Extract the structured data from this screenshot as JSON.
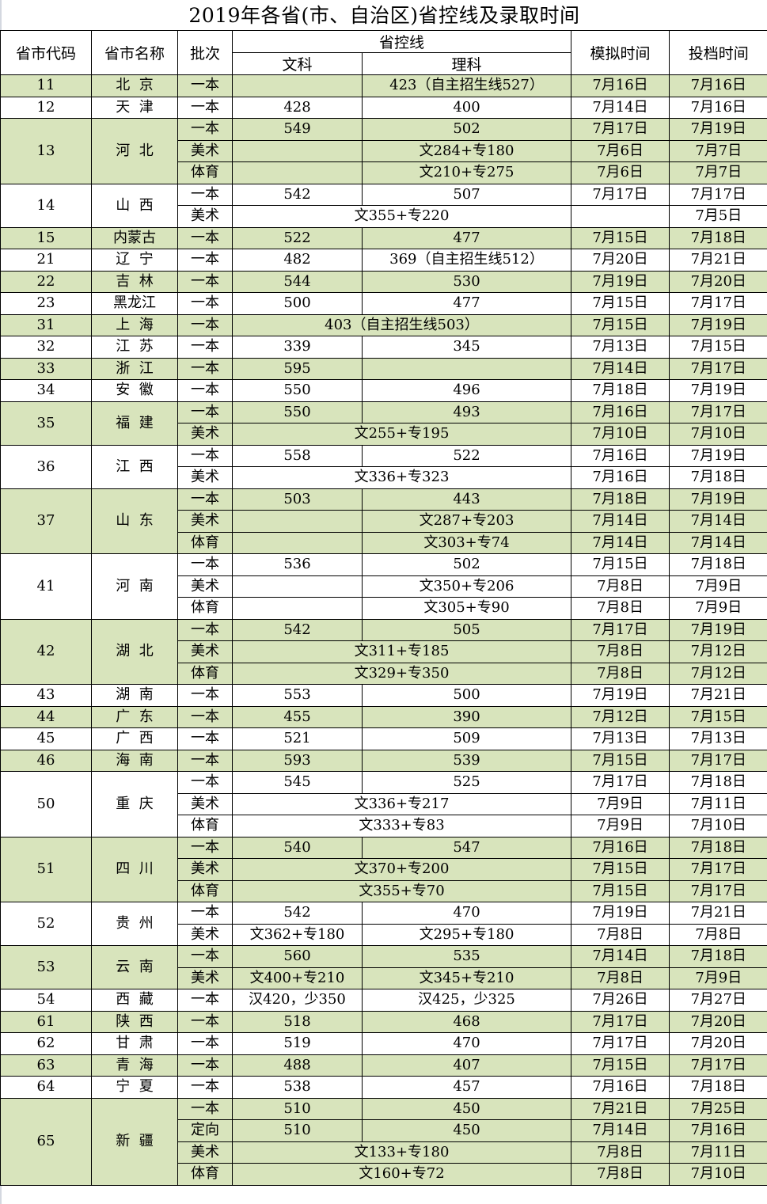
{
  "title": "2019年各省(市、自治区)省控线及录取时间",
  "colors": {
    "band_green": "#d8e4bc",
    "band_white": "#ffffff",
    "border": "#000000"
  },
  "headers": {
    "code": "省市代码",
    "name": "省市名称",
    "batch": "批次",
    "control_line": "省控线",
    "arts": "文科",
    "science": "理科",
    "mock_time": "模拟时间",
    "file_time": "投档时间"
  },
  "provinces": [
    {
      "code": "11",
      "name": "北  京",
      "band": "g",
      "rows": [
        {
          "batch": "一本",
          "arts": "",
          "science": "423（自主招生线527）",
          "mock": "7月16日",
          "file": "7月16日"
        }
      ]
    },
    {
      "code": "12",
      "name": "天  津",
      "band": "w",
      "rows": [
        {
          "batch": "一本",
          "arts": "428",
          "science": "400",
          "mock": "7月14日",
          "file": "7月16日"
        }
      ]
    },
    {
      "code": "13",
      "name": "河  北",
      "band": "g",
      "rows": [
        {
          "batch": "一本",
          "arts": "549",
          "science": "502",
          "mock": "7月17日",
          "file": "7月19日"
        },
        {
          "batch": "美术",
          "arts": "",
          "science": "文284+专180",
          "mock": "7月6日",
          "file": "7月7日"
        },
        {
          "batch": "体育",
          "arts": "",
          "science": "文210+专275",
          "mock": "7月6日",
          "file": "7月7日"
        }
      ]
    },
    {
      "code": "14",
      "name": "山  西",
      "band": "w",
      "rows": [
        {
          "batch": "一本",
          "arts": "542",
          "science": "507",
          "mock": "7月17日",
          "file": "7月17日"
        },
        {
          "batch": "美术",
          "merged": "文355+专220",
          "mock": "",
          "file": "7月5日"
        }
      ]
    },
    {
      "code": "15",
      "name": "内蒙古",
      "band": "g",
      "rows": [
        {
          "batch": "一本",
          "arts": "522",
          "science": "477",
          "mock": "7月15日",
          "file": "7月18日"
        }
      ]
    },
    {
      "code": "21",
      "name": "辽  宁",
      "band": "w",
      "rows": [
        {
          "batch": "一本",
          "arts": "482",
          "science": "369（自主招生线512）",
          "mock": "7月20日",
          "file": "7月21日"
        }
      ]
    },
    {
      "code": "22",
      "name": "吉  林",
      "band": "g",
      "rows": [
        {
          "batch": "一本",
          "arts": "544",
          "science": "530",
          "mock": "7月19日",
          "file": "7月20日"
        }
      ]
    },
    {
      "code": "23",
      "name": "黑龙江",
      "band": "w",
      "rows": [
        {
          "batch": "一本",
          "arts": "500",
          "science": "477",
          "mock": "7月15日",
          "file": "7月17日"
        }
      ]
    },
    {
      "code": "31",
      "name": "上  海",
      "band": "g",
      "rows": [
        {
          "batch": "一本",
          "merged": "403（自主招生线503）",
          "mock": "7月15日",
          "file": "7月19日"
        }
      ]
    },
    {
      "code": "32",
      "name": "江  苏",
      "band": "w",
      "rows": [
        {
          "batch": "一本",
          "arts": "339",
          "science": "345",
          "mock": "7月13日",
          "file": "7月15日"
        }
      ]
    },
    {
      "code": "33",
      "name": "浙  江",
      "band": "g",
      "rows": [
        {
          "batch": "一本",
          "arts": "595",
          "science": "",
          "mock": "7月14日",
          "file": "7月17日"
        }
      ]
    },
    {
      "code": "34",
      "name": "安  徽",
      "band": "w",
      "rows": [
        {
          "batch": "一本",
          "arts": "550",
          "science": "496",
          "mock": "7月18日",
          "file": "7月19日"
        }
      ]
    },
    {
      "code": "35",
      "name": "福  建",
      "band": "g",
      "rows": [
        {
          "batch": "一本",
          "arts": "550",
          "science": "493",
          "mock": "7月16日",
          "file": "7月17日"
        },
        {
          "batch": "美术",
          "merged": "文255+专195",
          "mock": "7月10日",
          "file": "7月10日"
        }
      ]
    },
    {
      "code": "36",
      "name": "江  西",
      "band": "w",
      "rows": [
        {
          "batch": "一本",
          "arts": "558",
          "science": "522",
          "mock": "7月16日",
          "file": "7月19日"
        },
        {
          "batch": "美术",
          "merged": "文336+专323",
          "mock": "7月16日",
          "file": "7月18日"
        }
      ]
    },
    {
      "code": "37",
      "name": "山  东",
      "band": "g",
      "rows": [
        {
          "batch": "一本",
          "arts": "503",
          "science": "443",
          "mock": "7月18日",
          "file": "7月19日"
        },
        {
          "batch": "美术",
          "arts": "",
          "science": "文287+专203",
          "mock": "7月14日",
          "file": "7月14日"
        },
        {
          "batch": "体育",
          "arts": "",
          "science": "文303+专74",
          "mock": "7月14日",
          "file": "7月14日"
        }
      ]
    },
    {
      "code": "41",
      "name": "河  南",
      "band": "w",
      "rows": [
        {
          "batch": "一本",
          "arts": "536",
          "science": "502",
          "mock": "7月15日",
          "file": "7月18日"
        },
        {
          "batch": "美术",
          "arts": "",
          "science": "文350+专206",
          "mock": "7月8日",
          "file": "7月9日"
        },
        {
          "batch": "体育",
          "arts": "",
          "science": "文305+专90",
          "mock": "7月8日",
          "file": "7月9日"
        }
      ]
    },
    {
      "code": "42",
      "name": "湖  北",
      "band": "g",
      "rows": [
        {
          "batch": "一本",
          "arts": "542",
          "science": "505",
          "mock": "7月17日",
          "file": "7月19日"
        },
        {
          "batch": "美术",
          "merged": "文311+专185",
          "mock": "7月8日",
          "file": "7月12日"
        },
        {
          "batch": "体育",
          "merged": "文329+专350",
          "mock": "7月8日",
          "file": "7月12日"
        }
      ]
    },
    {
      "code": "43",
      "name": "湖  南",
      "band": "w",
      "rows": [
        {
          "batch": "一本",
          "arts": "553",
          "science": "500",
          "mock": "7月19日",
          "file": "7月21日"
        }
      ]
    },
    {
      "code": "44",
      "name": "广  东",
      "band": "g",
      "rows": [
        {
          "batch": "一本",
          "arts": "455",
          "science": "390",
          "mock": "7月12日",
          "file": "7月15日"
        }
      ]
    },
    {
      "code": "45",
      "name": "广  西",
      "band": "w",
      "rows": [
        {
          "batch": "一本",
          "arts": "521",
          "science": "509",
          "mock": "7月13日",
          "file": "7月13日"
        }
      ]
    },
    {
      "code": "46",
      "name": "海  南",
      "band": "g",
      "rows": [
        {
          "batch": "一本",
          "arts": "593",
          "science": "539",
          "mock": "7月15日",
          "file": "7月17日"
        }
      ]
    },
    {
      "code": "50",
      "name": "重  庆",
      "band": "w",
      "rows": [
        {
          "batch": "一本",
          "arts": "545",
          "science": "525",
          "mock": "7月17日",
          "file": "7月18日"
        },
        {
          "batch": "美术",
          "merged": "文336+专217",
          "mock": "7月9日",
          "file": "7月11日"
        },
        {
          "batch": "体育",
          "merged": "文333+专83",
          "mock": "7月9日",
          "file": "7月10日"
        }
      ]
    },
    {
      "code": "51",
      "name": "四  川",
      "band": "g",
      "rows": [
        {
          "batch": "一本",
          "arts": "540",
          "science": "547",
          "mock": "7月16日",
          "file": "7月18日"
        },
        {
          "batch": "美术",
          "merged": "文370+专200",
          "mock": "7月15日",
          "file": "7月17日"
        },
        {
          "batch": "体育",
          "merged": "文355+专70",
          "mock": "7月15日",
          "file": "7月17日"
        }
      ]
    },
    {
      "code": "52",
      "name": "贵  州",
      "band": "w",
      "rows": [
        {
          "batch": "一本",
          "arts": "542",
          "science": "470",
          "mock": "7月19日",
          "file": "7月21日"
        },
        {
          "batch": "美术",
          "arts": "文362+专180",
          "science": "文295+专180",
          "mock": "7月8日",
          "file": "7月8日"
        }
      ]
    },
    {
      "code": "53",
      "name": "云  南",
      "band": "g",
      "rows": [
        {
          "batch": "一本",
          "arts": "560",
          "science": "535",
          "mock": "7月14日",
          "file": "7月18日"
        },
        {
          "batch": "美术",
          "arts": "文400+专210",
          "science": "文345+专210",
          "mock": "7月8日",
          "file": "7月9日"
        }
      ]
    },
    {
      "code": "54",
      "name": "西  藏",
      "band": "w",
      "rows": [
        {
          "batch": "一本",
          "arts": "汉420，少350",
          "science": "汉425，少325",
          "mock": "7月26日",
          "file": "7月27日"
        }
      ]
    },
    {
      "code": "61",
      "name": "陕  西",
      "band": "g",
      "rows": [
        {
          "batch": "一本",
          "arts": "518",
          "science": "468",
          "mock": "7月17日",
          "file": "7月20日"
        }
      ]
    },
    {
      "code": "62",
      "name": "甘  肃",
      "band": "w",
      "rows": [
        {
          "batch": "一本",
          "arts": "519",
          "science": "470",
          "mock": "7月17日",
          "file": "7月20日"
        }
      ]
    },
    {
      "code": "63",
      "name": "青  海",
      "band": "g",
      "rows": [
        {
          "batch": "一本",
          "arts": "488",
          "science": "407",
          "mock": "7月15日",
          "file": "7月17日"
        }
      ]
    },
    {
      "code": "64",
      "name": "宁  夏",
      "band": "w",
      "rows": [
        {
          "batch": "一本",
          "arts": "538",
          "science": "457",
          "mock": "7月16日",
          "file": "7月18日"
        }
      ]
    },
    {
      "code": "65",
      "name": "新  疆",
      "band": "g",
      "rows": [
        {
          "batch": "一本",
          "arts": "510",
          "science": "450",
          "mock": "7月21日",
          "file": "7月25日"
        },
        {
          "batch": "定向",
          "arts": "510",
          "science": "450",
          "mock": "7月14日",
          "file": "7月16日"
        },
        {
          "batch": "美术",
          "merged": "文133+专180",
          "mock": "7月8日",
          "file": "7月11日"
        },
        {
          "batch": "体育",
          "merged": "文160+专72",
          "mock": "7月8日",
          "file": "7月10日"
        }
      ]
    }
  ]
}
